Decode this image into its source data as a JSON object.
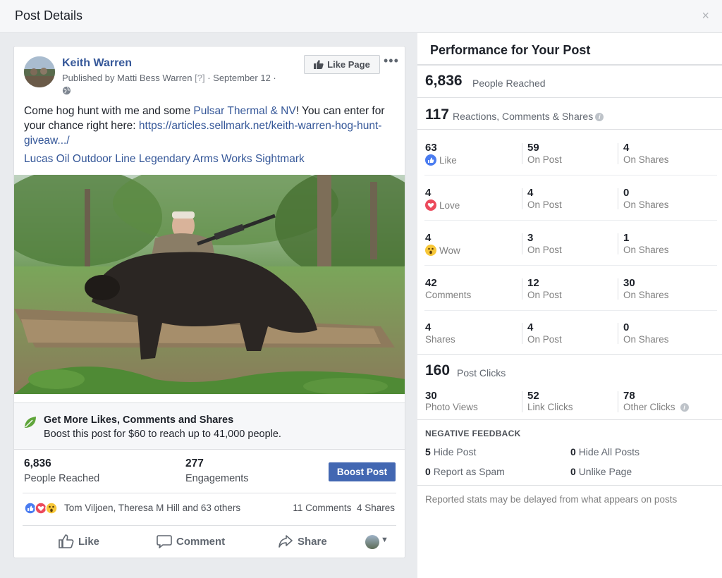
{
  "dialog": {
    "title": "Post Details",
    "close": "×"
  },
  "post": {
    "page_name": "Keith Warren",
    "published_by": "Published by Matti Bess Warren",
    "help_marker": "[?]",
    "date": "· September 12 ·",
    "like_page_label": "Like Page",
    "more": "•••",
    "text_1": "Come hog hunt with me and some ",
    "text_link_1": "Pulsar Thermal & NV",
    "text_2": "! You can enter for your chance right here: ",
    "text_link_2": "https://articles.sellmark.net/keith-warren-hog-hunt-giveaw...",
    "text_link_2_end": "/",
    "tags": "Lucas Oil Outdoor Line Legendary Arms Works Sightmark"
  },
  "boost": {
    "title": "Get More Likes, Comments and Shares",
    "subtitle": "Boost this post for $60 to reach up to 41,000 people.",
    "button": "Boost Post"
  },
  "summary": {
    "reached_value": "6,836",
    "reached_label": "People Reached",
    "engagements_value": "277",
    "engagements_label": "Engagements"
  },
  "reactions_line": {
    "names": "Tom Viljoen, Theresa M Hill and 63 others",
    "comments": "11 Comments",
    "shares": "4 Shares"
  },
  "actions": {
    "like": "Like",
    "comment": "Comment",
    "share": "Share"
  },
  "performance": {
    "title": "Performance for Your Post",
    "reached_value": "6,836",
    "reached_label": "People Reached",
    "rcs_value": "117",
    "rcs_label": "Reactions, Comments & Shares",
    "rows": [
      {
        "total": "63",
        "label": "Like",
        "icon": "like-icon",
        "on_post": "59",
        "on_post_label": "On Post",
        "on_shares": "4",
        "on_shares_label": "On Shares"
      },
      {
        "total": "4",
        "label": "Love",
        "icon": "love-icon",
        "on_post": "4",
        "on_post_label": "On Post",
        "on_shares": "0",
        "on_shares_label": "On Shares"
      },
      {
        "total": "4",
        "label": "Wow",
        "icon": "wow-icon",
        "on_post": "3",
        "on_post_label": "On Post",
        "on_shares": "1",
        "on_shares_label": "On Shares"
      },
      {
        "total": "42",
        "label": "Comments",
        "icon": "",
        "on_post": "12",
        "on_post_label": "On Post",
        "on_shares": "30",
        "on_shares_label": "On Shares"
      },
      {
        "total": "4",
        "label": "Shares",
        "icon": "",
        "on_post": "4",
        "on_post_label": "On Post",
        "on_shares": "0",
        "on_shares_label": "On Shares"
      }
    ],
    "clicks_value": "160",
    "clicks_label": "Post Clicks",
    "photo_views": "30",
    "photo_views_label": "Photo Views",
    "link_clicks": "52",
    "link_clicks_label": "Link Clicks",
    "other_clicks": "78",
    "other_clicks_label": "Other Clicks",
    "negative_title": "NEGATIVE FEEDBACK",
    "hide_post_value": "5",
    "hide_post_label": "Hide Post",
    "hide_all_value": "0",
    "hide_all_label": "Hide All Posts",
    "spam_value": "0",
    "spam_label": "Report as Spam",
    "unlike_value": "0",
    "unlike_label": "Unlike Page",
    "note": "Reported stats may be delayed from what appears on posts"
  },
  "colors": {
    "fb_blue": "#4267b2",
    "link": "#365899",
    "panel_bg": "#e9ebee"
  }
}
